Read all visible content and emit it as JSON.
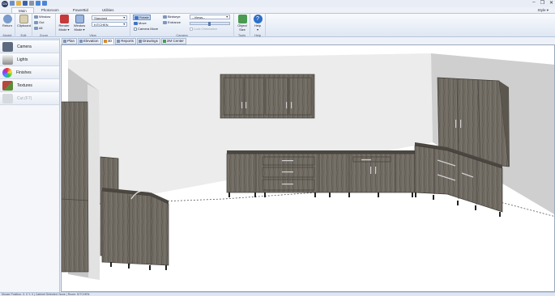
{
  "app": {
    "logo_text": "CV",
    "window_controls": {
      "minimize": "–",
      "restore": "❐",
      "close": "✕"
    },
    "style_menu": "Style ▾"
  },
  "ribbon_tabs": [
    {
      "label": "Main",
      "active": true
    },
    {
      "label": "Photoroom",
      "active": false
    },
    {
      "label": "PowerBid",
      "active": false
    },
    {
      "label": "Utilities",
      "active": false
    }
  ],
  "ribbon": {
    "groups": {
      "model": {
        "label": "Model",
        "return": "Return"
      },
      "edit": {
        "label": "Edit",
        "clipboard": "Clipboard",
        "clipboard_sub": "▾"
      },
      "zoom": {
        "label": "Zoom",
        "window": "Window",
        "out": "Out",
        "all": "All"
      },
      "view": {
        "label": "View",
        "render_mode": "Render\nMode ▾",
        "window_mode": "Window\nMode ▾",
        "style_select": "Standard",
        "room_select": "KITCHEN"
      },
      "camera": {
        "label": "Camera",
        "rotate": "Rotate",
        "move": "Move",
        "camera_move": "Camera Move",
        "bird_eye": "Birdseye",
        "entrance": "Entrance",
        "lock_orientation": "Lock Orientation",
        "views_select": "--Views--"
      },
      "tools": {
        "label": "Tools",
        "object_size": "Object\nSize"
      },
      "help": {
        "label": "Help",
        "help_button": "Help\n▾"
      }
    }
  },
  "sidebar": {
    "items": [
      {
        "label": "Camera",
        "enabled": true
      },
      {
        "label": "Lights",
        "enabled": true
      },
      {
        "label": "Finishes",
        "enabled": true
      },
      {
        "label": "Textures",
        "enabled": true
      },
      {
        "label": "Cut (F7)",
        "enabled": false
      }
    ]
  },
  "view_tabs": [
    {
      "label": "Plan",
      "active": false
    },
    {
      "label": "Elevation",
      "active": false
    },
    {
      "label": "3D",
      "active": true
    },
    {
      "label": "Reports",
      "active": false
    },
    {
      "label": "Drawings",
      "active": false
    },
    {
      "label": "2M Center",
      "active": false
    }
  ],
  "colors": {
    "cabinet_wood": "#6f6a62",
    "wall_back": "#ededed",
    "wall_right": "#cfcfcf",
    "wall_left": "#bfbfbf",
    "accent": "#2b5797"
  },
  "status": {
    "text": "Mouse Position: X: 0  Y: 0  |  Cabinet Selected: None  |  Room: KITCHEN"
  }
}
